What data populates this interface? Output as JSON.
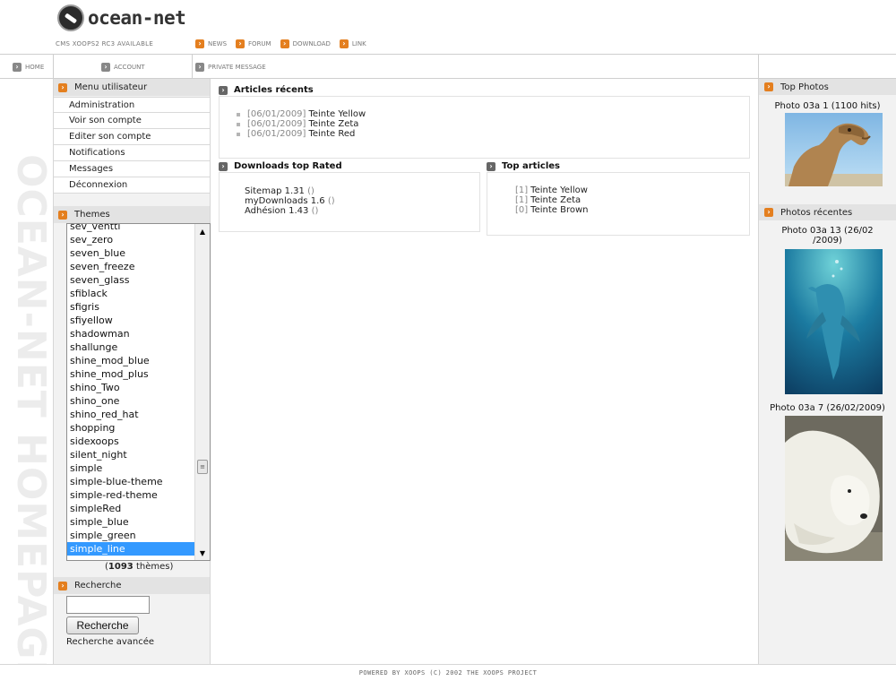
{
  "header": {
    "logo_text": "ocean-net",
    "tagline": "CMS XOOPS2 RC3 AVAILABLE",
    "nav": [
      "NEWS",
      "FORUM",
      "DOWNLOAD",
      "LINK"
    ]
  },
  "subnav": {
    "home": "HOME",
    "account": "ACCOUNT",
    "private_message": "PRIVATE MESSAGE"
  },
  "sidebar_vertical_text": "OCEAN-NET HOMEPAGE",
  "user_menu": {
    "title": "Menu utilisateur",
    "items": [
      "Administration",
      "Voir son compte",
      "Editer son compte",
      "Notifications",
      "Messages",
      "Déconnexion"
    ]
  },
  "themes": {
    "title": "Themes",
    "options": [
      "sev_ventti",
      "sev_zero",
      "seven_blue",
      "seven_freeze",
      "seven_glass",
      "sfiblack",
      "sfigris",
      "sfiyellow",
      "shadowman",
      "shallunge",
      "shine_mod_blue",
      "shine_mod_plus",
      "shino_Two",
      "shino_one",
      "shino_red_hat",
      "shopping",
      "sidexoops",
      "silent_night",
      "simple",
      "simple-blue-theme",
      "simple-red-theme",
      "simpleRed",
      "simple_blue",
      "simple_green",
      "simple_line"
    ],
    "selected": "simple_line",
    "count_number": "1093",
    "count_suffix": "thèmes"
  },
  "search": {
    "title": "Recherche",
    "input_value": "",
    "button_label": "Recherche",
    "advanced_label": "Recherche avancée"
  },
  "recent_articles": {
    "title": "Articles récents",
    "items": [
      {
        "date": "[06/01/2009]",
        "title": "Teinte Yellow"
      },
      {
        "date": "[06/01/2009]",
        "title": "Teinte Zeta"
      },
      {
        "date": "[06/01/2009]",
        "title": "Teinte Red"
      }
    ]
  },
  "downloads_top_rated": {
    "title": "Downloads top Rated",
    "items": [
      {
        "name": "Sitemap 1.31",
        "paren": "()"
      },
      {
        "name": "myDownloads 1.6",
        "paren": "()"
      },
      {
        "name": "Adhésion 1.43",
        "paren": "()"
      }
    ]
  },
  "top_articles": {
    "title": "Top articles",
    "items": [
      {
        "count": "[1]",
        "title": "Teinte Yellow"
      },
      {
        "count": "[1]",
        "title": "Teinte Zeta"
      },
      {
        "count": "[0]",
        "title": "Teinte Brown"
      }
    ]
  },
  "top_photos": {
    "title": "Top Photos",
    "items": [
      {
        "caption": "Photo 03a 1 (1100 hits)",
        "icon": "camel-photo"
      }
    ]
  },
  "recent_photos": {
    "title": "Photos récentes",
    "items": [
      {
        "caption": "Photo 03a 13 (26/02 /2009)",
        "icon": "dolphin-photo"
      },
      {
        "caption": "Photo 03a 7 (26/02/2009)",
        "icon": "polar-bear-photo"
      }
    ]
  },
  "footer": "POWERED BY XOOPS (C) 2002 THE XOOPS PROJECT",
  "colors": {
    "accent_orange": "#e47f1f",
    "selected_blue": "#3399ff",
    "panel_gray": "#f2f2f2",
    "header_gray": "#e3e3e3"
  }
}
